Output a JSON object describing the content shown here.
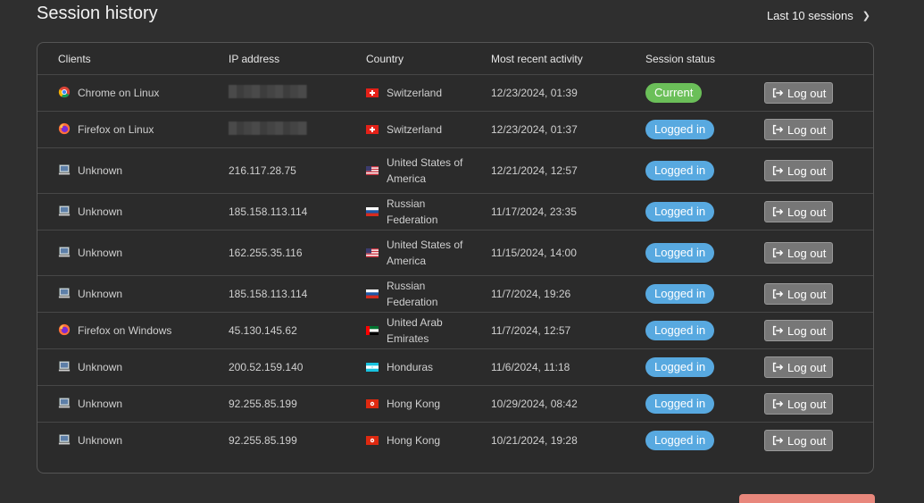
{
  "title": "Session history",
  "range": {
    "label": "Last 10 sessions"
  },
  "columns": {
    "clients": "Clients",
    "ip": "IP address",
    "country": "Country",
    "activity": "Most recent activity",
    "status": "Session status"
  },
  "logout_label": "Log out",
  "rows": [
    {
      "client": "Chrome on Linux",
      "client_icon": "chrome-icon",
      "ip": "",
      "ip_hidden": true,
      "country": "Switzerland",
      "flag": "ch",
      "activity": "12/23/2024, 01:39",
      "status": "Current"
    },
    {
      "client": "Firefox on Linux",
      "client_icon": "firefox-icon",
      "ip": "",
      "ip_hidden": true,
      "country": "Switzerland",
      "flag": "ch",
      "activity": "12/23/2024, 01:37",
      "status": "Logged in"
    },
    {
      "client": "Unknown",
      "client_icon": "computer-icon",
      "ip": "216.117.28.75",
      "country": "United States of America",
      "flag": "us",
      "activity": "12/21/2024, 12:57",
      "status": "Logged in"
    },
    {
      "client": "Unknown",
      "client_icon": "computer-icon",
      "ip": "185.158.113.114",
      "country": "Russian Federation",
      "flag": "ru",
      "activity": "11/17/2024, 23:35",
      "status": "Logged in"
    },
    {
      "client": "Unknown",
      "client_icon": "computer-icon",
      "ip": "162.255.35.116",
      "country": "United States of America",
      "flag": "us",
      "activity": "11/15/2024, 14:00",
      "status": "Logged in"
    },
    {
      "client": "Unknown",
      "client_icon": "computer-icon",
      "ip": "185.158.113.114",
      "country": "Russian Federation",
      "flag": "ru",
      "activity": "11/7/2024, 19:26",
      "status": "Logged in"
    },
    {
      "client": "Firefox on Windows",
      "client_icon": "firefox-icon",
      "ip": "45.130.145.62",
      "country": "United Arab Emirates",
      "flag": "ae",
      "activity": "11/7/2024, 12:57",
      "status": "Logged in"
    },
    {
      "client": "Unknown",
      "client_icon": "computer-icon",
      "ip": "200.52.159.140",
      "country": "Honduras",
      "flag": "hn",
      "activity": "11/6/2024, 11:18",
      "status": "Logged in"
    },
    {
      "client": "Unknown",
      "client_icon": "computer-icon",
      "ip": "92.255.85.199",
      "country": "Hong Kong",
      "flag": "hk",
      "activity": "10/29/2024, 08:42",
      "status": "Logged in"
    },
    {
      "client": "Unknown",
      "client_icon": "computer-icon",
      "ip": "92.255.85.199",
      "country": "Hong Kong",
      "flag": "hk",
      "activity": "10/21/2024, 19:28",
      "status": "Logged in"
    }
  ],
  "colors": {
    "background": "#2f2f2f",
    "current": "#6bbf59",
    "logged_in": "#58a9e0",
    "button": "#777777"
  }
}
